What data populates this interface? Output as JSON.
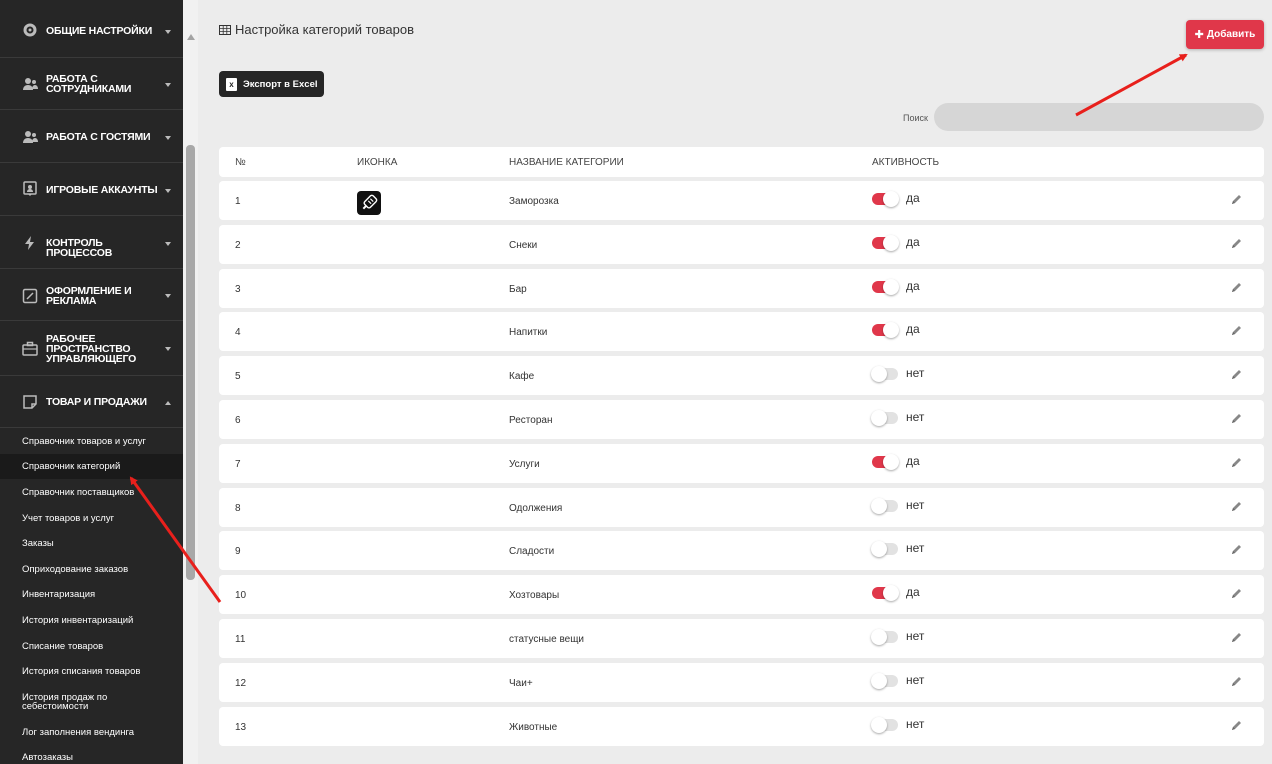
{
  "sidebar": {
    "items": [
      {
        "label": "ОБЩИЕ НАСТРОЙКИ",
        "icon": "gear-icon"
      },
      {
        "label": "РАБОТА С СОТРУДНИКАМИ",
        "icon": "users-icon"
      },
      {
        "label": "РАБОТА С ГОСТЯМИ",
        "icon": "guests-icon"
      },
      {
        "label": "ИГРОВЫЕ АККАУНТЫ",
        "icon": "account-icon"
      },
      {
        "label": "КОНТРОЛЬ ПРОЦЕССОВ",
        "icon": "bolt-icon"
      },
      {
        "label": "ОФОРМЛЕНИЕ И РЕКЛАМА",
        "icon": "edit-square-icon"
      },
      {
        "label": "РАБОЧЕЕ ПРОСТРАНСТВО УПРАВЛЯЮЩЕГО",
        "icon": "briefcase-icon"
      },
      {
        "label": "ТОВАР И ПРОДАЖИ",
        "icon": "note-icon"
      }
    ],
    "subitems": [
      {
        "label": "Справочник товаров и услуг"
      },
      {
        "label": "Справочник категорий"
      },
      {
        "label": "Справочник поставщиков"
      },
      {
        "label": "Учет товаров и услуг"
      },
      {
        "label": "Заказы"
      },
      {
        "label": "Оприходование заказов"
      },
      {
        "label": "Инвентаризация"
      },
      {
        "label": "История инвентаризаций"
      },
      {
        "label": "Списание товаров"
      },
      {
        "label": "История списания товаров"
      },
      {
        "label": "История продаж по себестоимости"
      },
      {
        "label": "Лог заполнения вендинга"
      },
      {
        "label": "Автозаказы"
      }
    ]
  },
  "header": {
    "title": "Настройка категорий товаров",
    "add_label": "Добавить",
    "excel_label": "Экспорт в Excel",
    "search_label": "Поиск",
    "search_placeholder": ""
  },
  "table": {
    "columns": [
      "№",
      "ИКОНКА",
      "НАЗВАНИЕ КАТЕГОРИИ",
      "АКТИВНОСТЬ"
    ],
    "rows": [
      {
        "num": "1",
        "name": "Заморозка",
        "active": true,
        "status": "да",
        "has_icon": true
      },
      {
        "num": "2",
        "name": "Снеки",
        "active": true,
        "status": "да"
      },
      {
        "num": "3",
        "name": "Бар",
        "active": true,
        "status": "да"
      },
      {
        "num": "4",
        "name": "Напитки",
        "active": true,
        "status": "да"
      },
      {
        "num": "5",
        "name": "Кафе",
        "active": false,
        "status": "нет"
      },
      {
        "num": "6",
        "name": "Ресторан",
        "active": false,
        "status": "нет"
      },
      {
        "num": "7",
        "name": "Услуги",
        "active": true,
        "status": "да"
      },
      {
        "num": "8",
        "name": "Одолжения",
        "active": false,
        "status": "нет"
      },
      {
        "num": "9",
        "name": "Сладости",
        "active": false,
        "status": "нет"
      },
      {
        "num": "10",
        "name": "Хозтовары",
        "active": true,
        "status": "да"
      },
      {
        "num": "11",
        "name": "статусные вещи",
        "active": false,
        "status": "нет"
      },
      {
        "num": "12",
        "name": "Чаи+",
        "active": false,
        "status": "нет"
      },
      {
        "num": "13",
        "name": "Животные",
        "active": false,
        "status": "нет"
      }
    ]
  },
  "colors": {
    "accent": "#e0374a",
    "sidebar_bg": "#262626",
    "page_bg": "#ececec",
    "annotation_arrow": "#e8201c"
  }
}
